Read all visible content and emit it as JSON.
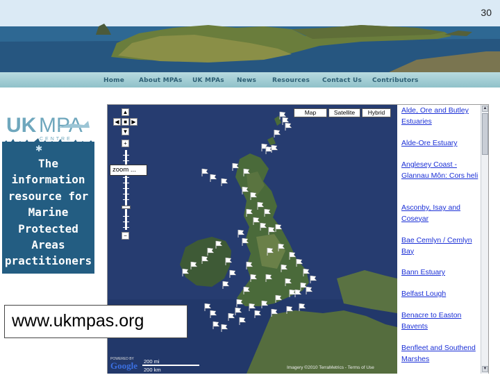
{
  "slide": {
    "number": "30"
  },
  "nav": {
    "items": [
      "Home",
      "About MPAs",
      "UK MPAs",
      "News",
      "Resources",
      "Contact Us",
      "Contributors"
    ]
  },
  "logo": {
    "text_uk": "UK",
    "text_mpa": "MPA",
    "text_centre": "CENTRE"
  },
  "tagline": "The\ninformation\nresource for\nMarine\nProtected\nAreas\npractitioners",
  "url": "www.ukmpas.org",
  "map": {
    "types": [
      "Map",
      "Satellite",
      "Hybrid"
    ],
    "zoom_tooltip": "zoom ...",
    "scale_top": "200 mi",
    "scale_bottom": "200 km",
    "google_label": "Google",
    "powered_by": "POWERED BY",
    "attribution": "Imagery ©2010 TerraMetrics - Terms of Use"
  },
  "sidebar": {
    "links": [
      "Alde, Ore and Butley Estuaries",
      "Alde-Ore Estuary",
      "Anglesey Coast - Glannau Môn: Cors heli",
      "Asconby, Isay and Coseyar",
      "Bae Cemlyn / Cemlyn Bay",
      "Bann Estuary",
      "Belfast Lough",
      "Benacre to Easton Bavents",
      "Benfleet and Southend Marshes"
    ]
  },
  "colors": {
    "sea": "#253a6e",
    "link": "#1a2fd6",
    "tagline_bg": "#235d82",
    "nav_bg": "#a3cdd4"
  }
}
